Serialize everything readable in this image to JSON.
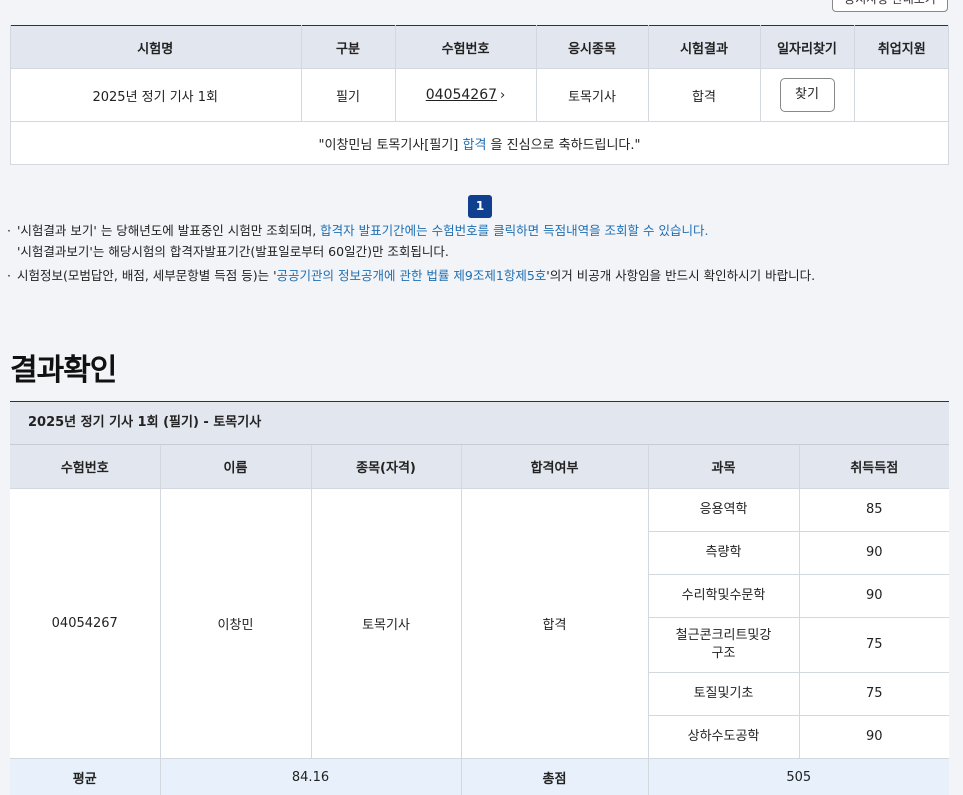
{
  "top_button": {
    "label": "공지사항 안내보기"
  },
  "exam_table": {
    "headers": [
      "시험명",
      "구분",
      "수험번호",
      "응시종목",
      "시험결과",
      "일자리찾기",
      "취업지원"
    ],
    "row": {
      "exam_name": "2025년 정기 기사 1회",
      "type": "필기",
      "exam_no": "04054267",
      "subject": "토목기사",
      "result": "합격",
      "find_label": "찾기",
      "support": ""
    },
    "message": {
      "before": "\"이창민님 토목기사[필기] ",
      "highlight": "합격",
      "after": " 을 진심으로 축하드립니다.\""
    }
  },
  "pagination": {
    "current": "1"
  },
  "notes": [
    {
      "parts": [
        {
          "text": "'시험결과 보기' 는 당해년도에 발표중인 시험만 조회되며, ",
          "blue": false
        },
        {
          "text": "합격자 발표기간에는 수험번호를 클릭하면 득점내역을 조회할 수 있습니다.",
          "blue": true
        }
      ],
      "second_line": "'시험결과보기'는 해당시험의 합격자발표기간(발표일로부터 60일간)만 조회됩니다."
    },
    {
      "parts": [
        {
          "text": "시험정보(모범답안, 배점, 세부문항별 득점 등)는 '",
          "blue": false
        },
        {
          "text": "공공기관의 정보공개에 관한 법률 제9조제1항제5호",
          "blue": true
        },
        {
          "text": "'의거 비공개 사항임을 반드시 확인하시기 바랍니다.",
          "blue": false
        }
      ]
    }
  ],
  "result_section": {
    "title": "결과확인",
    "caption": "2025년 정기 기사 1회 (필기) - 토목기사",
    "headers": [
      "수험번호",
      "이름",
      "종목(자격)",
      "합격여부",
      "과목",
      "취득득점"
    ],
    "exam_no": "04054267",
    "name": "이창민",
    "qualification": "토목기사",
    "pass": "합격",
    "subjects": [
      {
        "name": "응용역학",
        "score": "85"
      },
      {
        "name": "측량학",
        "score": "90"
      },
      {
        "name": "수리학및수문학",
        "score": "90"
      },
      {
        "name": "철근콘크리트및강구조",
        "score": "75"
      },
      {
        "name": "토질및기초",
        "score": "75"
      },
      {
        "name": "상하수도공학",
        "score": "90"
      }
    ],
    "avg_label": "평균",
    "avg_value": "84.16",
    "total_label": "총점",
    "total_value": "505"
  },
  "colors": {
    "accent": "#103f8f",
    "link": "#1f6fb2",
    "header_bg": "#e2e6ee",
    "summary_bg": "#e8f1fb"
  }
}
